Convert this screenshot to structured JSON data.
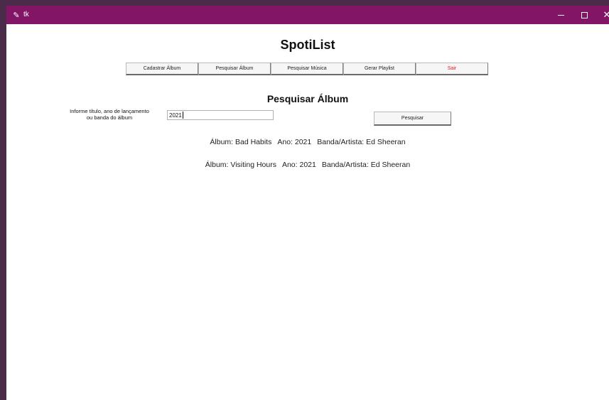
{
  "window": {
    "title": "tk",
    "title_bar_color": "#821566",
    "controls": [
      "minimize-icon",
      "maximize-icon",
      "close-icon"
    ],
    "close_glyph": "✕"
  },
  "app": {
    "title": "SpotiList"
  },
  "nav": {
    "items": [
      {
        "label": "Cadastrar Álbum"
      },
      {
        "label": "Pesquisar Álbum"
      },
      {
        "label": "Pesquisar Música"
      },
      {
        "label": "Gerar Playlist"
      },
      {
        "label": "Sair",
        "color": "#e02020"
      }
    ]
  },
  "search": {
    "section_title": "Pesquisar Álbum",
    "label_line1": "Informe título, ano de lançamento",
    "label_line2": "ou banda do álbum",
    "value": "2021",
    "button_label": "Pesquisar"
  },
  "results": [
    {
      "album": "Álbum: Bad Habits",
      "year": "Ano: 2021",
      "artist": "Banda/Artista: Ed Sheeran"
    },
    {
      "album": "Álbum: Visiting Hours",
      "year": "Ano: 2021",
      "artist": "Banda/Artista: Ed Sheeran"
    }
  ]
}
